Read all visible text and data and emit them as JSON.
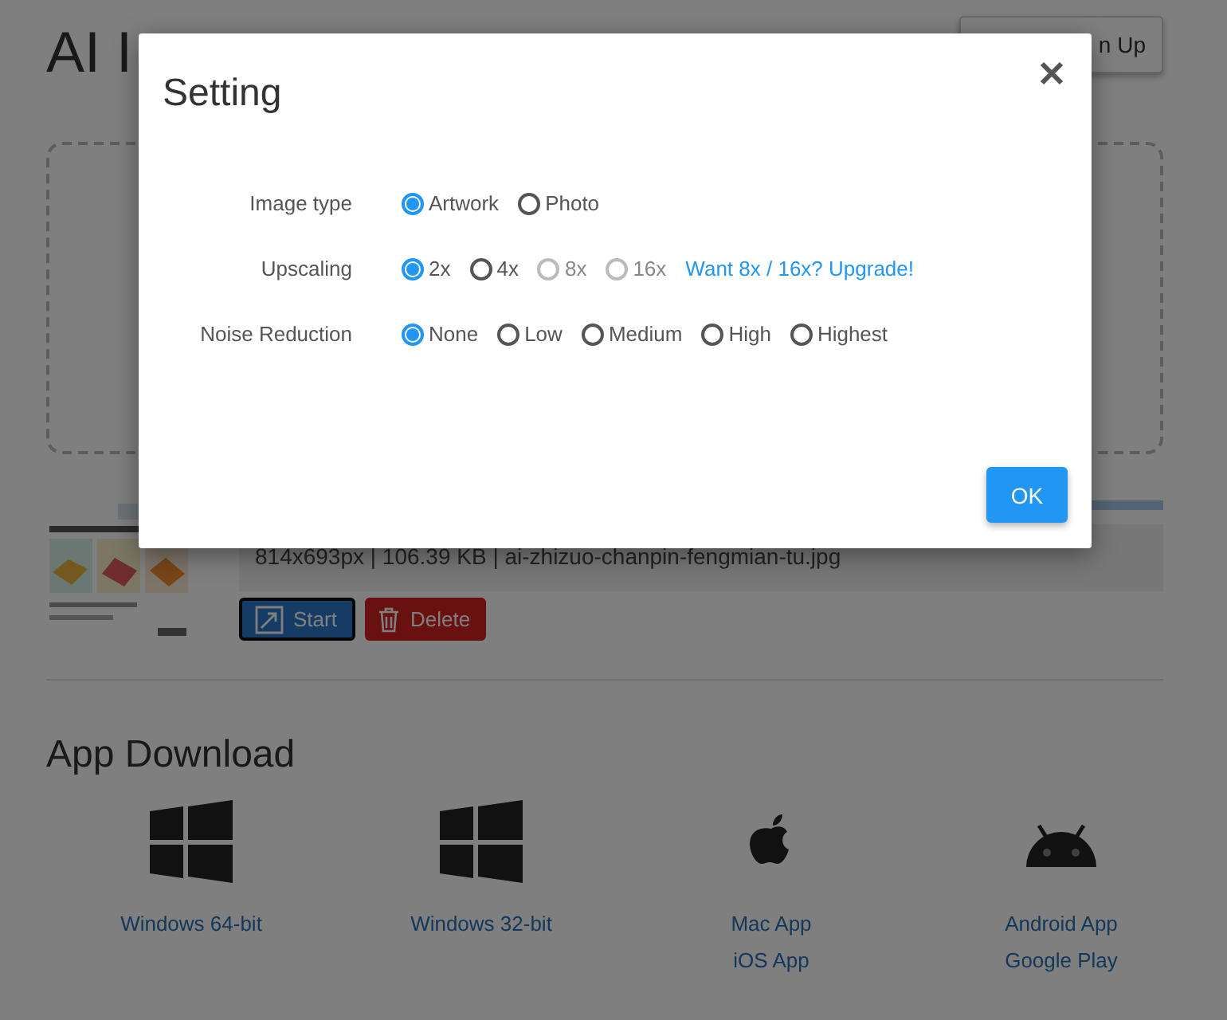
{
  "header": {
    "title": "AI I",
    "signup_button": "n Up"
  },
  "upload": {
    "progress": {
      "level": 1
    },
    "info": "814x693px | 106.39 KB | ai-zhizuo-chanpin-fengmian-tu.jpg",
    "buttons": [
      {
        "label": "Start",
        "kind": "start"
      },
      {
        "label": "Delete",
        "kind": "delete"
      }
    ]
  },
  "app_download": {
    "title": "App Download",
    "platforms": [
      {
        "kind": "windows",
        "links": [
          "Windows 64-bit"
        ]
      },
      {
        "kind": "windows",
        "links": [
          "Windows 32-bit"
        ]
      },
      {
        "kind": "apple",
        "links": [
          "Mac App",
          "iOS App"
        ]
      },
      {
        "kind": "android",
        "links": [
          "Android App",
          "Google Play"
        ]
      }
    ]
  },
  "dialog": {
    "title": "Setting",
    "settings": [
      {
        "label": "Image type",
        "options": [
          {
            "label": "Artwork",
            "selected": true,
            "disabled": false
          },
          {
            "label": "Photo",
            "selected": false,
            "disabled": false
          }
        ]
      },
      {
        "label": "Upscaling",
        "options": [
          {
            "label": "2x",
            "selected": true,
            "disabled": false
          },
          {
            "label": "4x",
            "selected": false,
            "disabled": false
          },
          {
            "label": "8x",
            "selected": false,
            "disabled": true
          },
          {
            "label": "16x",
            "selected": false,
            "disabled": true
          }
        ],
        "link": "Want 8x / 16x? Upgrade!"
      },
      {
        "label": "Noise Reduction",
        "options": [
          {
            "label": "None",
            "selected": true,
            "disabled": false
          },
          {
            "label": "Low",
            "selected": false,
            "disabled": false
          },
          {
            "label": "Medium",
            "selected": false,
            "disabled": false
          },
          {
            "label": "High",
            "selected": false,
            "disabled": false
          },
          {
            "label": "Highest",
            "selected": false,
            "disabled": false
          }
        ]
      }
    ],
    "ok_button": "OK"
  }
}
